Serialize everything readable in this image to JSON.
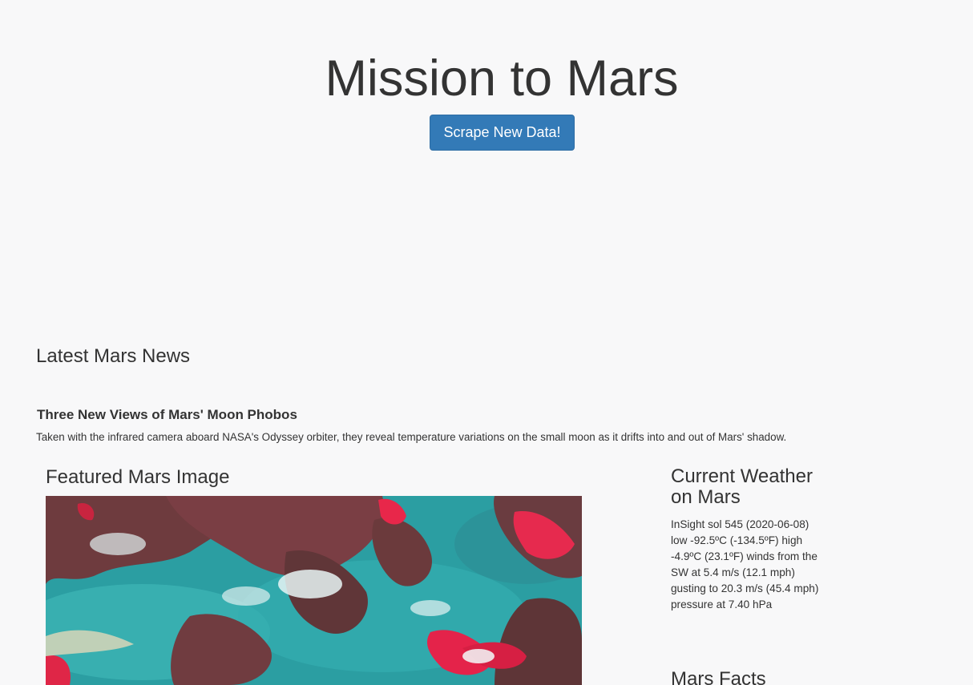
{
  "header": {
    "title": "Mission to Mars",
    "scrape_button_label": "Scrape New Data!"
  },
  "news": {
    "section_title": "Latest Mars News",
    "headline": "Three New Views of Mars' Moon Phobos",
    "teaser": "Taken with the infrared camera aboard NASA's Odyssey orbiter, they reveal temperature variations on the small moon as it drifts into and out of Mars' shadow."
  },
  "featured_image": {
    "section_title": "Featured Mars Image"
  },
  "weather": {
    "section_title": "Current Weather on Mars",
    "report": "InSight sol 545 (2020-06-08) low -92.5ºC (-134.5ºF) high -4.9ºC (23.1ºF) winds from the SW at 5.4 m/s (12.1 mph) gusting to 20.3 m/s (45.4 mph) pressure at 7.40 hPa"
  },
  "facts": {
    "section_title": "Mars Facts"
  },
  "colors": {
    "page_background": "#f8f8f9",
    "text": "#333333",
    "button_primary": "#337ab7",
    "button_border": "#2e6da4"
  }
}
